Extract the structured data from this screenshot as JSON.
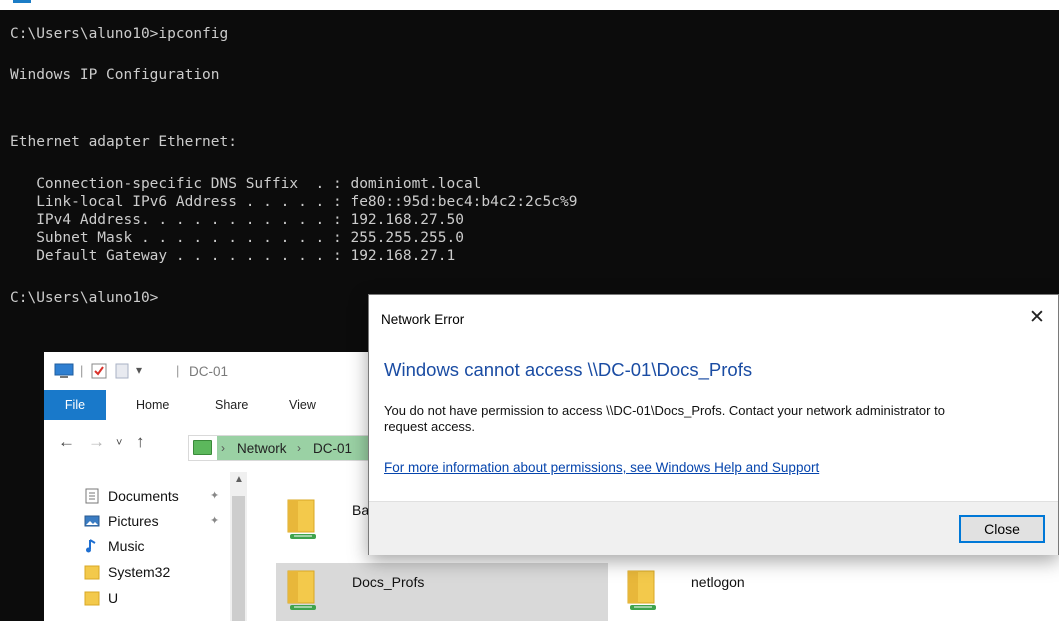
{
  "console": {
    "prompt1": "C:\\Users\\aluno10>ipconfig",
    "header": "Windows IP Configuration",
    "adapter": "Ethernet adapter Ethernet:",
    "entries": [
      "   Connection-specific DNS Suffix  . : dominiomt.local",
      "   Link-local IPv6 Address . . . . . : fe80::95d:bec4:b4c2:2c5c%9",
      "   IPv4 Address. . . . . . . . . . . : 192.168.27.50",
      "   Subnet Mask . . . . . . . . . . . : 255.255.255.0",
      "   Default Gateway . . . . . . . . . : 192.168.27.1"
    ],
    "prompt2": "C:\\Users\\aluno10>"
  },
  "explorer": {
    "title": "DC-01",
    "ribbon_tabs": [
      "File",
      "Home",
      "Share",
      "View"
    ],
    "address": {
      "segments": [
        "Network",
        "DC-01"
      ]
    },
    "nav_items": [
      {
        "label": "Documents",
        "icon": "documents-icon",
        "pinned": true
      },
      {
        "label": "Pictures",
        "icon": "pictures-icon",
        "pinned": true
      },
      {
        "label": "Music",
        "icon": "music-icon",
        "pinned": false
      },
      {
        "label": "System32",
        "icon": "folder-icon",
        "pinned": false
      },
      {
        "label": "U",
        "icon": "folder-icon",
        "pinned": false
      }
    ],
    "shares": [
      "Ba",
      "Docs_Profs",
      "netlogon"
    ],
    "selected_share": "Docs_Profs"
  },
  "dialog": {
    "title": "Network Error",
    "heading": "Windows cannot access \\\\DC-01\\Docs_Profs",
    "message": "You do not have permission to access \\\\DC-01\\Docs_Profs. Contact your network administrator to request access.",
    "link": "For more information about permissions, see Windows Help and Support",
    "close_label": "Close"
  },
  "colors": {
    "console_bg": "#0c0c0c",
    "console_text": "#cccccc",
    "file_tab": "#1979ca",
    "dialog_heading": "#1a4ca3",
    "link": "#0645ad",
    "button_focus": "#0078d7"
  }
}
